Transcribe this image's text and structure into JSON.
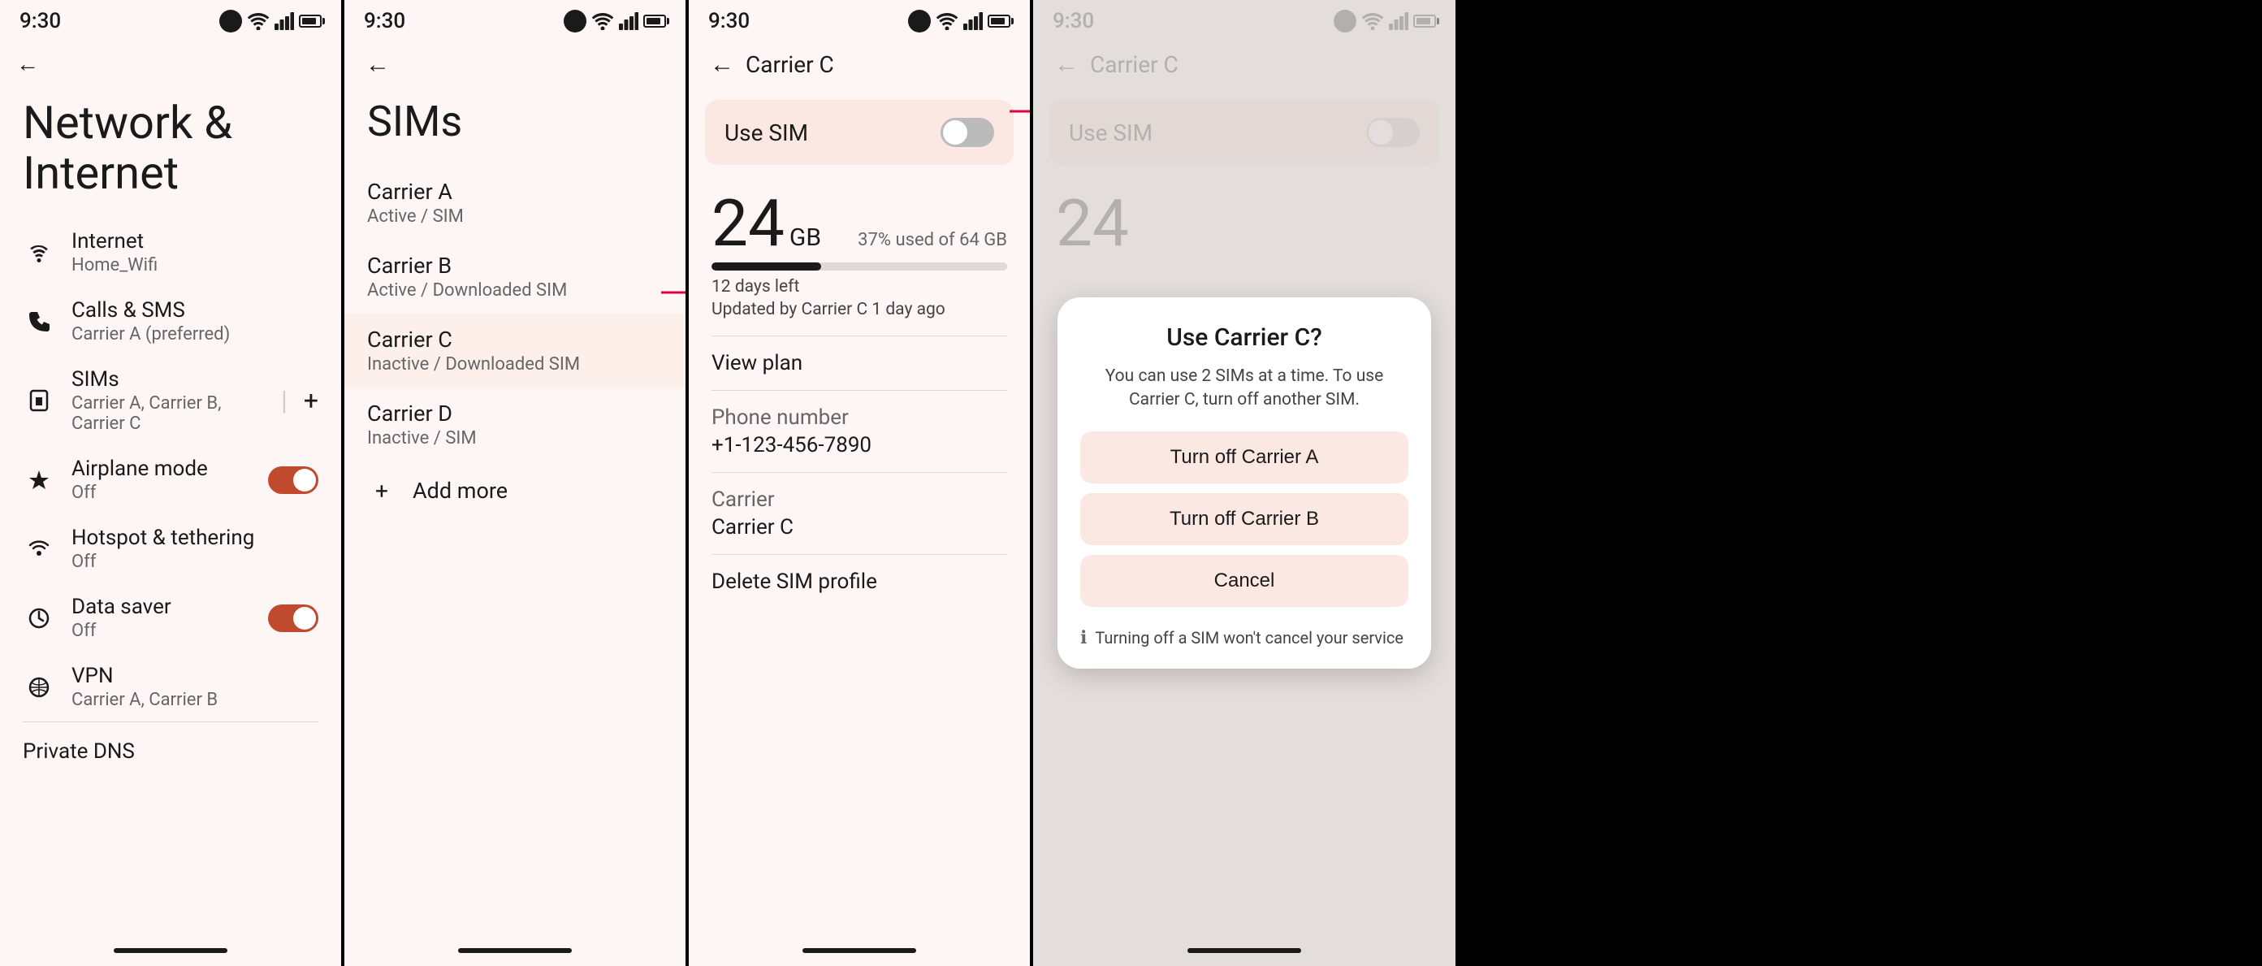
{
  "panel1": {
    "statusTime": "9:30",
    "title": "Network & Internet",
    "items": [
      {
        "id": "internet",
        "label": "Internet",
        "sublabel": "Home_Wifi",
        "icon": "wifi"
      },
      {
        "id": "calls-sms",
        "label": "Calls & SMS",
        "sublabel": "Carrier A (preferred)",
        "icon": "phone"
      },
      {
        "id": "sims",
        "label": "SIMs",
        "sublabel": "Carrier A, Carrier B, Carrier C",
        "icon": "sim"
      },
      {
        "id": "airplane",
        "label": "Airplane mode",
        "sublabel": "Off",
        "icon": "airplane",
        "toggle": true,
        "toggleOn": true
      },
      {
        "id": "hotspot",
        "label": "Hotspot & tethering",
        "sublabel": "Off",
        "icon": "hotspot"
      },
      {
        "id": "datasaver",
        "label": "Data saver",
        "sublabel": "Off",
        "icon": "datasaver",
        "toggle": true,
        "toggleOn": true
      },
      {
        "id": "vpn",
        "label": "VPN",
        "sublabel": "Carrier A, Carrier B",
        "icon": "vpn"
      }
    ],
    "bottomSection": "Private DNS"
  },
  "panel2": {
    "statusTime": "9:30",
    "title": "SIMs",
    "carriers": [
      {
        "id": "carrier-a",
        "label": "Carrier A",
        "sublabel": "Active / SIM"
      },
      {
        "id": "carrier-b",
        "label": "Carrier B",
        "sublabel": "Active / Downloaded SIM"
      },
      {
        "id": "carrier-c",
        "label": "Carrier C",
        "sublabel": "Inactive / Downloaded SIM"
      },
      {
        "id": "carrier-d",
        "label": "Carrier D",
        "sublabel": "Inactive / SIM"
      }
    ],
    "addMore": "Add more"
  },
  "panel3": {
    "statusTime": "9:30",
    "backTitle": "Carrier C",
    "useSim": "Use SIM",
    "dataNumber": "24",
    "dataUnit": "GB",
    "dataPercent": "37% used of 64 GB",
    "dataBarFill": 37,
    "daysLeft": "12 days left",
    "updatedBy": "Updated by Carrier C 1 day ago",
    "viewPlan": "View plan",
    "phoneNumberLabel": "Phone number",
    "phoneNumber": "+1-123-456-7890",
    "carrierLabel": "Carrier",
    "carrierValue": "Carrier C",
    "deleteSim": "Delete SIM profile"
  },
  "panel4": {
    "statusTime": "9:30",
    "backTitle": "Carrier C",
    "useSim": "Use SIM",
    "dataNumber": "24",
    "dialog": {
      "title": "Use Carrier C?",
      "desc": "You can use 2 SIMs at a time. To use Carrier C, turn off another SIM.",
      "btn1": "Turn off Carrier A",
      "btn2": "Turn off Carrier B",
      "btn3": "Cancel",
      "footerIcon": "ℹ",
      "footerText": "Turning off a SIM won't cancel your service"
    }
  },
  "arrows": {
    "color": "#e0004d"
  }
}
